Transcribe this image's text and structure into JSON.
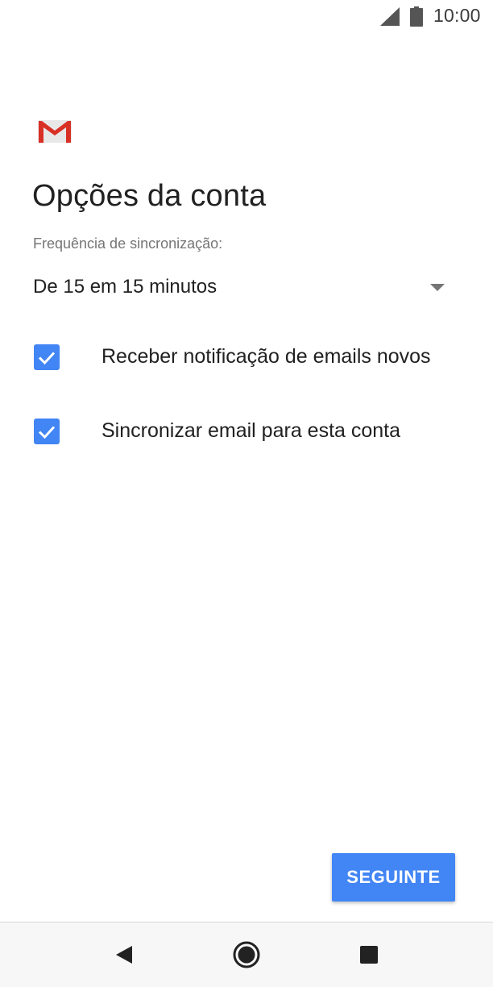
{
  "status_bar": {
    "time": "10:00",
    "icons": [
      "signal-icon",
      "battery-icon"
    ]
  },
  "header": {
    "logo": "gmail-logo",
    "title": "Opções da conta"
  },
  "sync": {
    "label": "Frequência de sincronização:",
    "selected_value": "De 15 em 15 minutos"
  },
  "options": [
    {
      "label": "Receber notificação de emails novos",
      "checked": true
    },
    {
      "label": "Sincronizar email para esta conta",
      "checked": true
    }
  ],
  "actions": {
    "next_label": "SEGUINTE"
  },
  "navigation": {
    "buttons": [
      "back-icon",
      "home-icon",
      "recents-icon"
    ]
  },
  "colors": {
    "accent": "#4285f4",
    "gmail_red": "#d93025",
    "text_primary": "#212121",
    "text_secondary": "#757575"
  }
}
